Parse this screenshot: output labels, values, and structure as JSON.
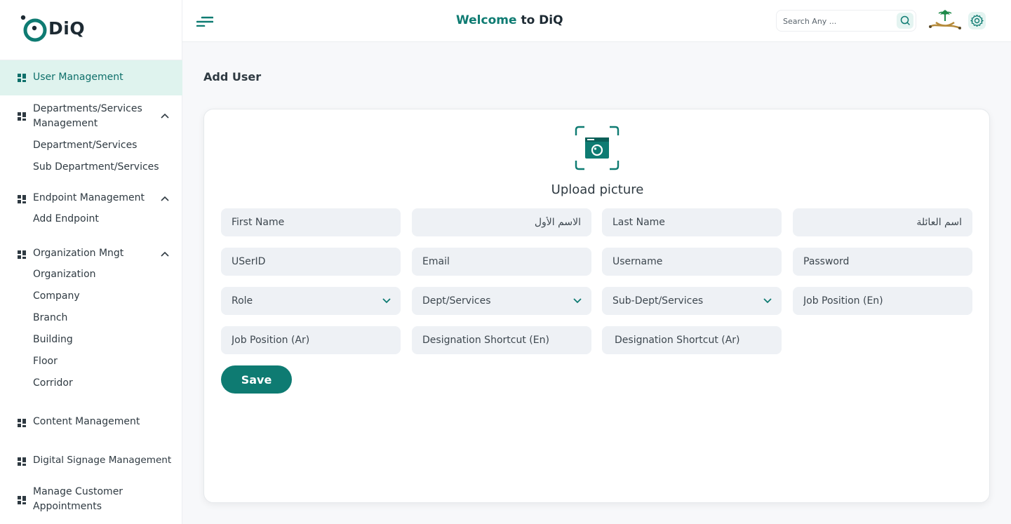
{
  "brand": {
    "name": "DiQ"
  },
  "header": {
    "welcome_prefix": "Welcome",
    "welcome_suffix": "to DiQ"
  },
  "search": {
    "placeholder": "Search Any ..."
  },
  "sidebar": {
    "active": "User Management",
    "sections": [
      {
        "label": "User Management"
      },
      {
        "label": "Departments/Services Management",
        "items": [
          "Department/Services",
          "Sub Department/Services"
        ]
      },
      {
        "label": "Endpoint Management",
        "items": [
          "Add Endpoint"
        ]
      },
      {
        "label": "Organization Mngt",
        "items": [
          "Organization",
          "Company",
          "Branch",
          "Building",
          "Floor",
          "Corridor"
        ]
      },
      {
        "label": "Content Management"
      },
      {
        "label": "Digital Signage Management"
      },
      {
        "label": "Manage Customer Appointments"
      }
    ]
  },
  "page": {
    "title": "Add User",
    "upload_label": "Upload picture"
  },
  "form": {
    "first_name": "First Name",
    "first_name_ar": "الاسم الأول",
    "last_name": "Last Name",
    "last_name_ar": "اسم العائلة",
    "userid": "USerID",
    "email": "Email",
    "username": "Username",
    "password": "Password",
    "role": "Role",
    "dept": "Dept/Services",
    "subdept": "Sub-Dept/Services",
    "job_en": "Job Position (En)",
    "job_ar": "Job Position (Ar)",
    "desig_en": "Designation Shortcut (En)",
    "desig_ar": "Designation Shortcut (Ar)",
    "save": "Save"
  },
  "colors": {
    "accent": "#0e7b72",
    "active_bg": "#dff3ee",
    "field_bg": "#eef1f5"
  },
  "icons": [
    "grid-icon",
    "chevron-up-icon",
    "chevron-down-icon",
    "menu-icon",
    "search-icon",
    "emblem-icon",
    "gear-icon",
    "camera-icon"
  ]
}
